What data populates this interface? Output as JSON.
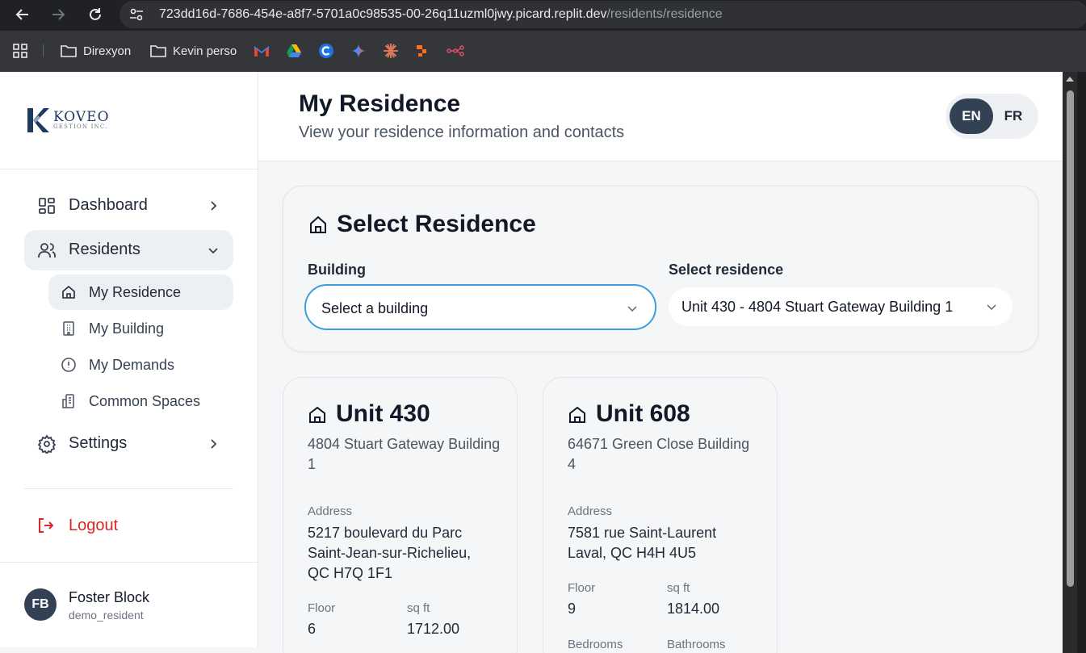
{
  "browser": {
    "url_host": "723dd16d-7686-454e-a8f7-5701a0c98535-00-26q11uzml0jwy.picard.replit.dev",
    "url_path": "/residents/residence",
    "bookmarks": [
      {
        "label": "Direxyon",
        "icon": "folder-icon"
      },
      {
        "label": "Kevin perso",
        "icon": "folder-icon"
      }
    ],
    "bookmark_icons": [
      "gmail-icon",
      "google-drive-icon",
      "c-app-icon",
      "gemini-icon",
      "claude-icon",
      "zapier-icon",
      "n8n-icon"
    ]
  },
  "sidebar": {
    "logo": {
      "name": "KOVEO",
      "tagline": "GESTION INC."
    },
    "nav": [
      {
        "label": "Dashboard",
        "icon": "dashboard-icon"
      },
      {
        "label": "Residents",
        "icon": "users-icon"
      },
      {
        "label": "Settings",
        "icon": "gear-icon"
      }
    ],
    "residents_sub": [
      {
        "label": "My Residence",
        "icon": "home-icon"
      },
      {
        "label": "My Building",
        "icon": "building-icon"
      },
      {
        "label": "My Demands",
        "icon": "alert-circle-icon"
      },
      {
        "label": "Common Spaces",
        "icon": "common-spaces-icon"
      }
    ],
    "logout_label": "Logout",
    "user": {
      "initials": "FB",
      "name": "Foster Block",
      "role": "demo_resident"
    }
  },
  "header": {
    "title": "My Residence",
    "subtitle": "View your residence information and contacts",
    "languages": [
      "EN",
      "FR"
    ],
    "active_language": "EN"
  },
  "select_card": {
    "title": "Select Residence",
    "building_label": "Building",
    "building_value": "Select a building",
    "residence_label": "Select residence",
    "residence_value": "Unit 430 - 4804 Stuart Gateway Building 1"
  },
  "units": [
    {
      "title": "Unit 430",
      "building": "4804 Stuart Gateway Building 1",
      "address_label": "Address",
      "address_line1": "5217 boulevard du Parc",
      "address_line2": "Saint-Jean-sur-Richelieu,",
      "address_line3": "QC H7Q 1F1",
      "floor_label": "Floor",
      "floor": "6",
      "sqft_label": "sq ft",
      "sqft": "1712.00"
    },
    {
      "title": "Unit 608",
      "building": "64671 Green Close Building 4",
      "address_label": "Address",
      "address_line1": "7581 rue Saint-Laurent",
      "address_line2": "Laval, QC H4H 4U5",
      "floor_label": "Floor",
      "floor": "9",
      "sqft_label": "sq ft",
      "sqft": "1814.00",
      "bedrooms_label": "Bedrooms",
      "bathrooms_label": "Bathrooms"
    }
  ]
}
